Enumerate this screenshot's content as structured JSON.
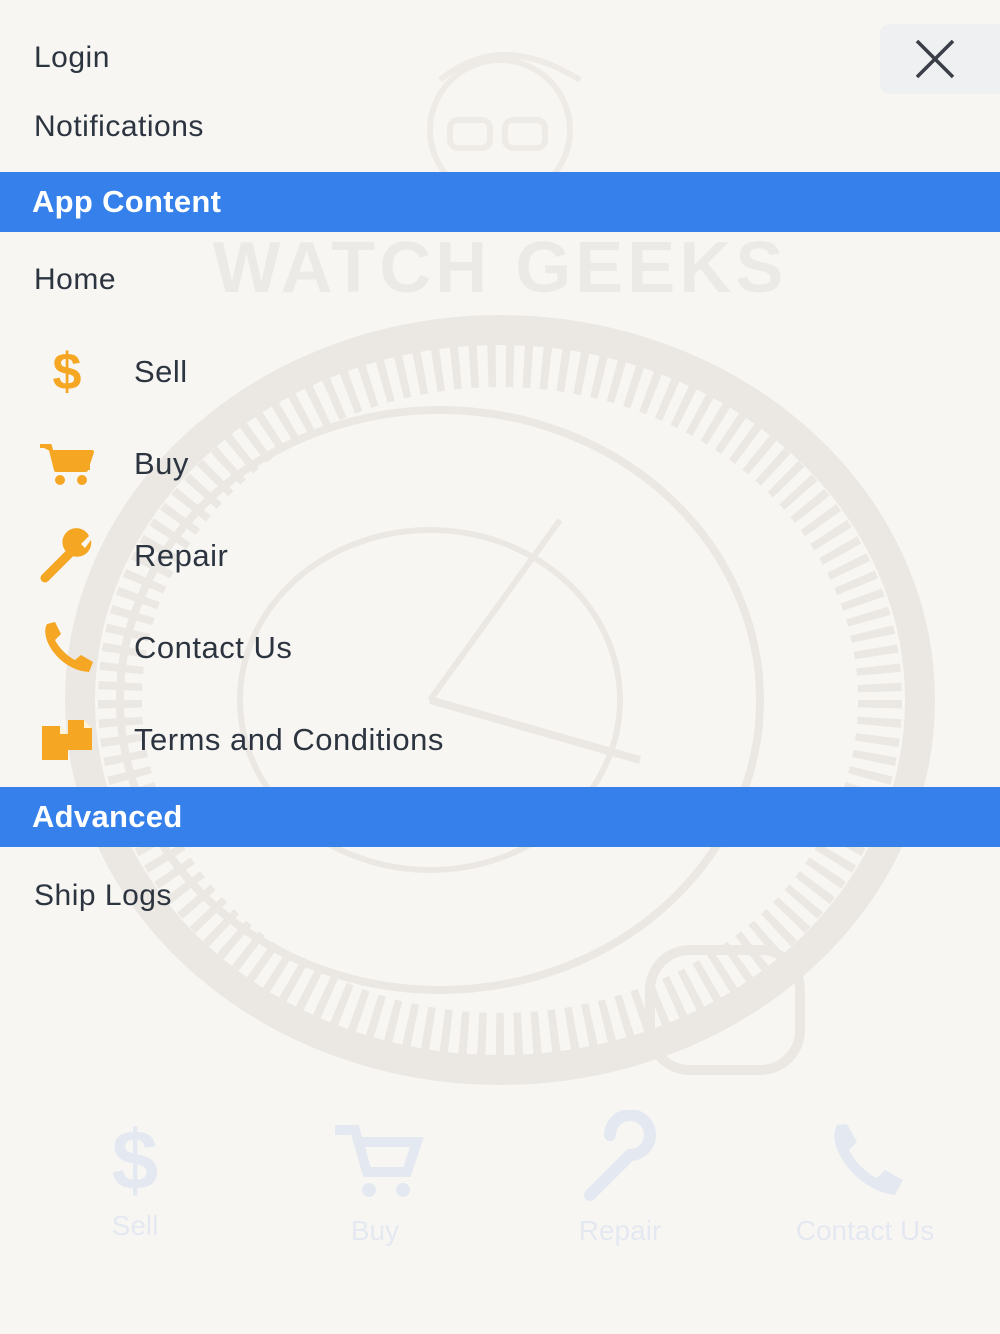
{
  "drawer": {
    "top_items": [
      {
        "name": "menu-item-login",
        "label": "Login"
      },
      {
        "name": "menu-item-notifications",
        "label": "Notifications"
      }
    ],
    "sections": {
      "app_content": "App Content",
      "advanced": "Advanced"
    },
    "home_label": "Home",
    "app_items": [
      {
        "name": "menu-item-sell",
        "icon": "dollar-icon",
        "label": "Sell"
      },
      {
        "name": "menu-item-buy",
        "icon": "cart-icon",
        "label": "Buy"
      },
      {
        "name": "menu-item-repair",
        "icon": "wrench-icon",
        "label": "Repair"
      },
      {
        "name": "menu-item-contact-us",
        "icon": "phone-icon",
        "label": "Contact Us"
      },
      {
        "name": "menu-item-terms",
        "icon": "documents-icon",
        "label": "Terms and Conditions"
      }
    ],
    "advanced_items": [
      {
        "name": "menu-item-ship-logs",
        "label": "Ship Logs"
      }
    ]
  },
  "background": {
    "brand_text": "WATCH GEEKS",
    "tab_bar": [
      {
        "icon": "dollar-icon",
        "label": "Sell"
      },
      {
        "icon": "cart-icon",
        "label": "Buy"
      },
      {
        "icon": "wrench-icon",
        "label": "Repair"
      },
      {
        "icon": "phone-icon",
        "label": "Contact Us"
      }
    ]
  },
  "colors": {
    "accent": "#3580ea",
    "icon": "#f5a623",
    "background": "#f8f6f3"
  }
}
